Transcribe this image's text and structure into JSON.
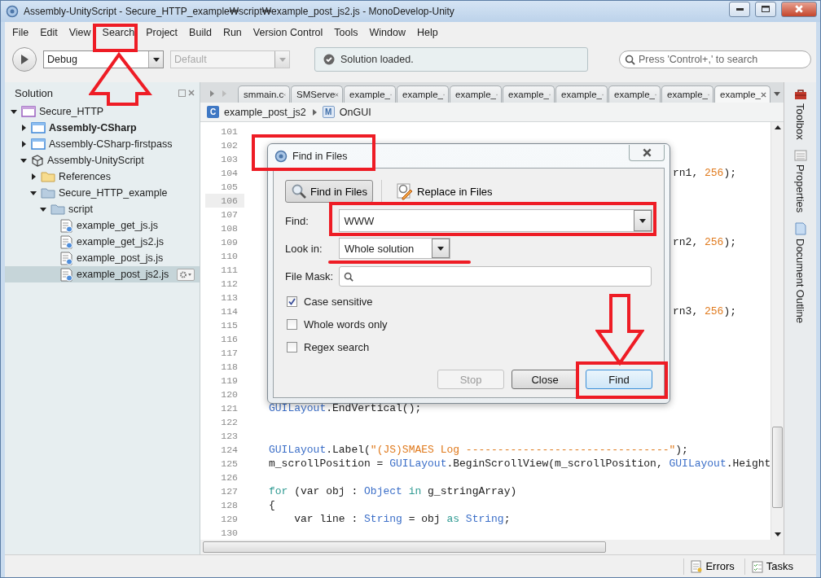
{
  "window": {
    "title": "Assembly-UnityScript - Secure_HTTP_example₩script₩example_post_js2.js - MonoDevelop-Unity"
  },
  "menu": [
    "File",
    "Edit",
    "View",
    "Search",
    "Project",
    "Build",
    "Run",
    "Version Control",
    "Tools",
    "Window",
    "Help"
  ],
  "toolbar": {
    "configuration": "Debug",
    "platform": {
      "value": "Default",
      "disabled": true
    },
    "status": "Solution loaded.",
    "search": {
      "placeholder": "Press 'Control+,' to search"
    }
  },
  "solution": {
    "title": "Solution",
    "tree": [
      {
        "label": "Secure_HTTP",
        "kind": "solution",
        "bold": false,
        "expanded": true,
        "selected": false,
        "children": [
          {
            "label": "Assembly-CSharp",
            "kind": "project",
            "bold": true,
            "expanded": false,
            "selected": false
          },
          {
            "label": "Assembly-CSharp-firstpass",
            "kind": "project",
            "bold": false,
            "expanded": false,
            "selected": false
          },
          {
            "label": "Assembly-UnityScript",
            "kind": "unity",
            "bold": false,
            "expanded": true,
            "selected": false,
            "children": [
              {
                "label": "References",
                "kind": "references",
                "bold": false,
                "expanded": false,
                "selected": false
              },
              {
                "label": "Secure_HTTP_example",
                "kind": "folder",
                "bold": false,
                "expanded": true,
                "selected": false,
                "children": [
                  {
                    "label": "script",
                    "kind": "folder",
                    "bold": false,
                    "expanded": true,
                    "selected": false,
                    "children": [
                      {
                        "label": "example_get_js.js",
                        "kind": "file",
                        "bold": false,
                        "selected": false
                      },
                      {
                        "label": "example_get_js2.js",
                        "kind": "file",
                        "bold": false,
                        "selected": false
                      },
                      {
                        "label": "example_post_js.js",
                        "kind": "file",
                        "bold": false,
                        "selected": false
                      },
                      {
                        "label": "example_post_js2.js",
                        "kind": "file",
                        "bold": false,
                        "selected": true
                      }
                    ]
                  }
                ]
              }
            ]
          }
        ]
      }
    ]
  },
  "editor": {
    "tabs": [
      {
        "label": "smmain.c",
        "selected": false
      },
      {
        "label": "SMServe",
        "selected": false
      },
      {
        "label": "example_",
        "selected": false
      },
      {
        "label": "example_",
        "selected": false
      },
      {
        "label": "example_",
        "selected": false
      },
      {
        "label": "example_",
        "selected": false
      },
      {
        "label": "example_",
        "selected": false
      },
      {
        "label": "example_",
        "selected": false
      },
      {
        "label": "example_",
        "selected": false
      },
      {
        "label": "example_",
        "selected": true
      }
    ],
    "breadcrumb": [
      {
        "badge": "C",
        "label": "example_post_js2"
      },
      {
        "badge": "M",
        "label": "OnGUI"
      }
    ],
    "lines": [
      {
        "number": "101",
        "current": false
      },
      {
        "number": "102",
        "current": false
      },
      {
        "number": "103",
        "current": false
      },
      {
        "number": "104",
        "kind": "partial",
        "current": false,
        "segments": [
          {
            "text": "rn1, ",
            "kind": "plain"
          },
          {
            "text": "256",
            "kind": "number"
          },
          {
            "text": ");",
            "kind": "plain"
          }
        ]
      },
      {
        "number": "105",
        "current": false
      },
      {
        "number": "106",
        "current": true
      },
      {
        "number": "107",
        "current": false
      },
      {
        "number": "108",
        "current": false
      },
      {
        "number": "109",
        "kind": "partial",
        "current": false,
        "segments": [
          {
            "text": "rn2, ",
            "kind": "plain"
          },
          {
            "text": "256",
            "kind": "number"
          },
          {
            "text": ");",
            "kind": "plain"
          }
        ]
      },
      {
        "number": "110",
        "current": false
      },
      {
        "number": "111",
        "current": false
      },
      {
        "number": "112",
        "current": false
      },
      {
        "number": "113",
        "current": false
      },
      {
        "number": "114",
        "kind": "partial",
        "current": false,
        "segments": [
          {
            "text": "rn3, ",
            "kind": "plain"
          },
          {
            "text": "256",
            "kind": "number"
          },
          {
            "text": ");",
            "kind": "plain"
          }
        ]
      },
      {
        "number": "115",
        "current": false
      },
      {
        "number": "116",
        "current": false
      },
      {
        "number": "117",
        "current": false
      },
      {
        "number": "118",
        "current": false
      },
      {
        "number": "119",
        "current": false
      },
      {
        "number": "120",
        "current": false
      },
      {
        "number": "121",
        "kind": "code",
        "current": false,
        "segments": [
          {
            "text": "GUILayout",
            "kind": "type"
          },
          {
            "text": ".EndVertical();",
            "kind": "plain"
          }
        ]
      },
      {
        "number": "122",
        "current": false
      },
      {
        "number": "123",
        "current": false
      },
      {
        "number": "124",
        "kind": "code",
        "current": false,
        "segments": [
          {
            "text": "GUILayout",
            "kind": "type"
          },
          {
            "text": ".Label(",
            "kind": "plain"
          },
          {
            "text": "\"(JS)SMAES Log --------------------------------\"",
            "kind": "string"
          },
          {
            "text": ");",
            "kind": "plain"
          }
        ]
      },
      {
        "number": "125",
        "kind": "code",
        "current": false,
        "segments": [
          {
            "text": "m_scrollPosition = ",
            "kind": "plain"
          },
          {
            "text": "GUILayout",
            "kind": "type"
          },
          {
            "text": ".BeginScrollView(m_scrollPosition, ",
            "kind": "plain"
          },
          {
            "text": "GUILayout",
            "kind": "type"
          },
          {
            "text": ".Height",
            "kind": "plain"
          }
        ]
      },
      {
        "number": "126",
        "current": false
      },
      {
        "number": "127",
        "kind": "code",
        "current": false,
        "segments": [
          {
            "text": "for",
            "kind": "keyword"
          },
          {
            "text": " (var obj : ",
            "kind": "plain"
          },
          {
            "text": "Object",
            "kind": "type"
          },
          {
            "text": " in",
            "kind": "keyword"
          },
          {
            "text": " g_stringArray)",
            "kind": "plain"
          }
        ]
      },
      {
        "number": "128",
        "kind": "code",
        "current": false,
        "segments": [
          {
            "text": "{",
            "kind": "plain"
          }
        ]
      },
      {
        "number": "129",
        "kind": "code",
        "current": false,
        "segments": [
          {
            "text": "    var line : ",
            "kind": "plain"
          },
          {
            "text": "String",
            "kind": "type"
          },
          {
            "text": " = obj ",
            "kind": "plain"
          },
          {
            "text": "as",
            "kind": "keyword"
          },
          {
            "text": " String",
            "kind": "type"
          },
          {
            "text": ";",
            "kind": "plain"
          }
        ]
      },
      {
        "number": "130",
        "current": false
      }
    ]
  },
  "dock": [
    {
      "label": "Toolbox",
      "kind": "toolbox"
    },
    {
      "label": "Properties",
      "kind": "properties"
    },
    {
      "label": "Document Outline",
      "kind": "outline"
    }
  ],
  "status_bar": [
    {
      "label": "Errors",
      "kind": "errors"
    },
    {
      "label": "Tasks",
      "kind": "tasks"
    }
  ],
  "dialog": {
    "title": "Find in Files",
    "modes": [
      {
        "label": "Find in Files",
        "kind": "find",
        "selected": true
      },
      {
        "label": "Replace in Files",
        "kind": "replace",
        "selected": false
      }
    ],
    "find": {
      "label": "Find:",
      "value": "WWW"
    },
    "look_in": {
      "label": "Look in:",
      "value": "Whole solution"
    },
    "file_mask": {
      "label": "File Mask:"
    },
    "options": [
      {
        "label": "Case sensitive",
        "checked": true
      },
      {
        "label": "Whole words only",
        "checked": false
      },
      {
        "label": "Regex search",
        "checked": false
      }
    ],
    "buttons": [
      {
        "label": "Stop",
        "disabled": true,
        "default": false
      },
      {
        "label": "Close",
        "disabled": false,
        "default": false
      },
      {
        "label": "Find",
        "disabled": false,
        "default": true
      }
    ]
  }
}
